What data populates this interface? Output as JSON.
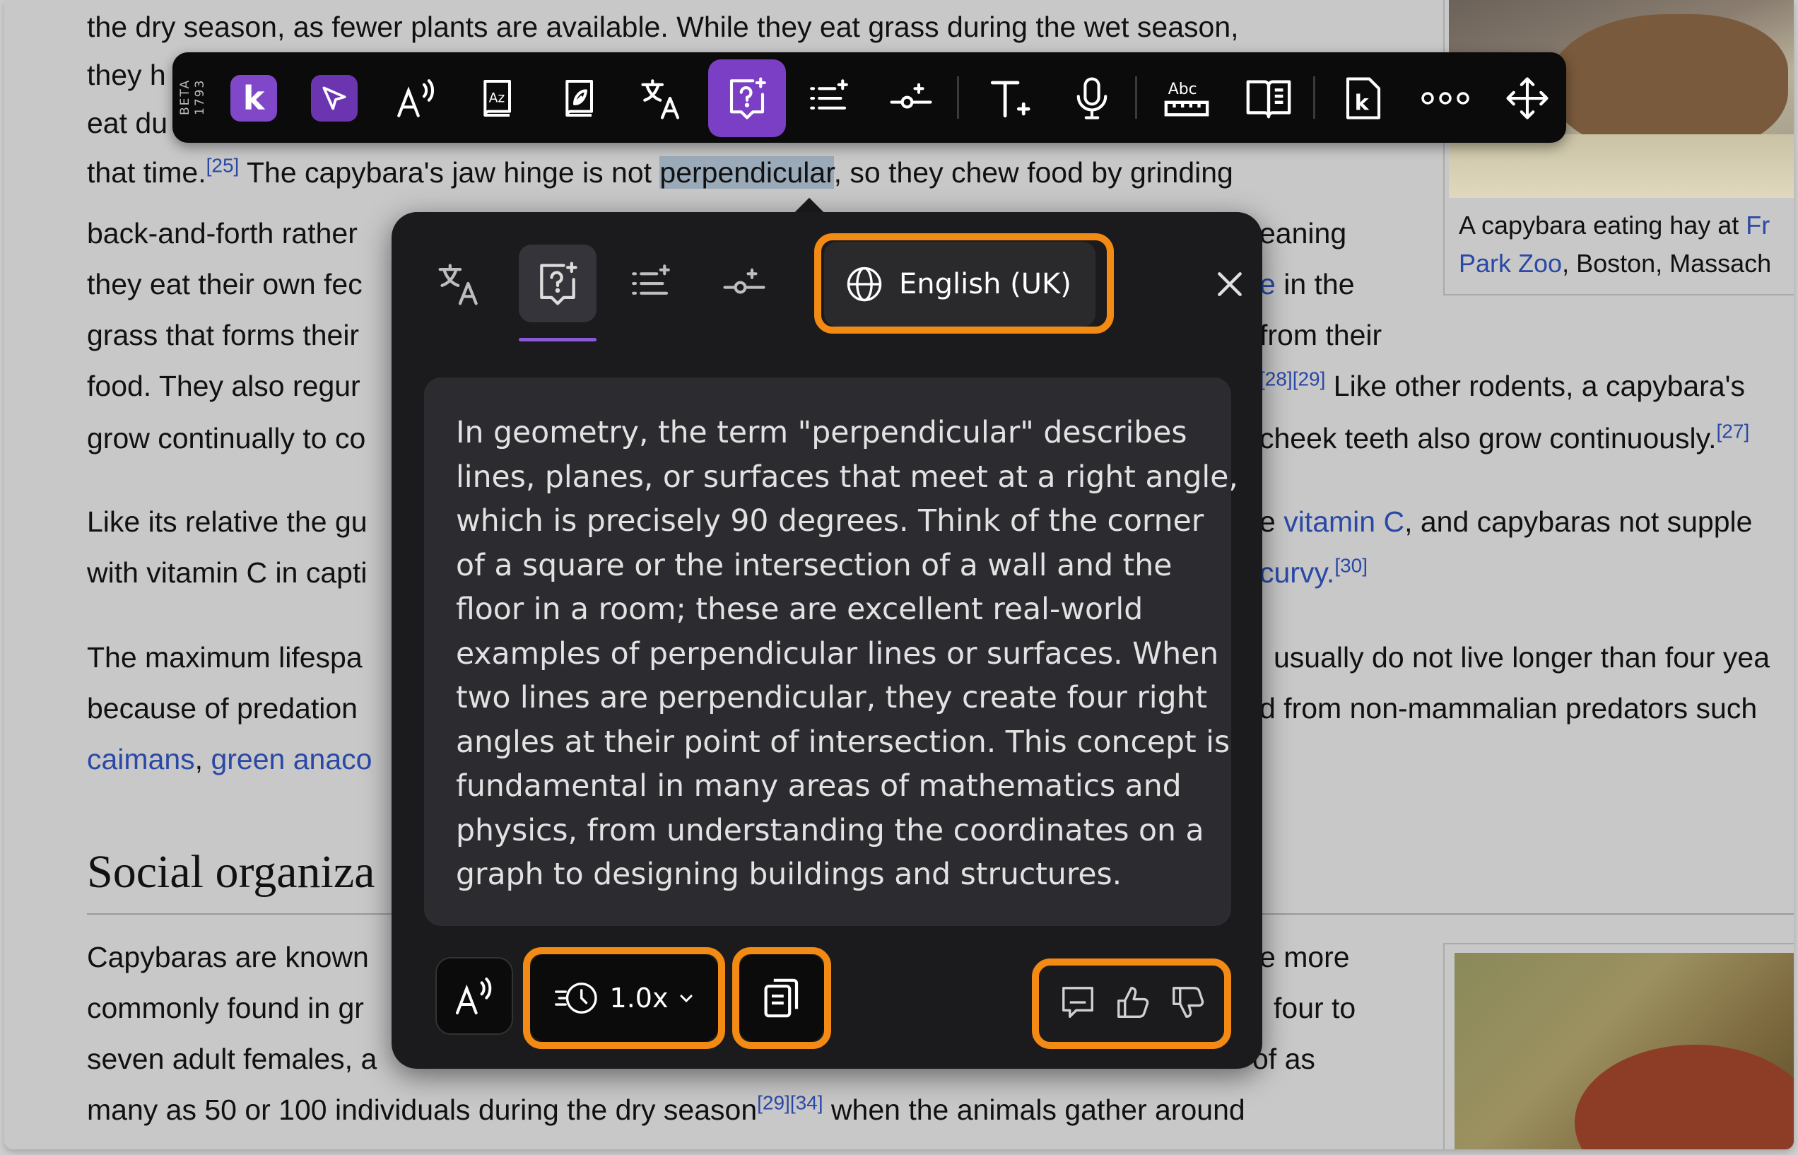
{
  "article": {
    "lines": [
      {
        "text": "the dry season, as fewer plants are available. While they eat grass during the wet season,"
      },
      {
        "text": "they h"
      },
      {
        "text": "eat du"
      },
      {
        "pre": "that time.",
        "sup": "[25]",
        "mid": " The capybara's jaw hinge is not ",
        "highlight": "perpendicular",
        "post": ", so they chew food by grinding"
      },
      {
        "text": "back-and-forth rather",
        "tail": "eaning"
      },
      {
        "text": "they eat their own fec",
        "tail_link": "e",
        "tail": " in the"
      },
      {
        "text": "grass that forms their",
        "tail": "from their"
      },
      {
        "text": "food. They also regur",
        "tail_sup": "[28][29]",
        "tail": " Like other rodents, a capybara's"
      },
      {
        "text": "grow continually to co",
        "tail": "cheek teeth also grow continuously.",
        "tail_sup2": "[27]"
      },
      {
        "text": "Like its relative the gu",
        "tail": "e ",
        "tail_link": "vitamin C",
        "tail2": ", and capybaras not supple"
      },
      {
        "text": "with vitamin C in capti",
        "tail_link": "curvy.",
        "tail_sup": "[30]"
      },
      {
        "text": "The maximum lifespa",
        "tail": "usually do not live longer than four yea"
      },
      {
        "text": "because of predation",
        "tail": "d from non-mammalian predators such"
      },
      {
        "link1": "caimans",
        "sep": ", ",
        "link2": "green anaco"
      },
      {
        "text": "Capybaras are known",
        "tail": "e more"
      },
      {
        "text": "commonly found in gr",
        "tail": "four to"
      },
      {
        "text": "seven adult females, a",
        "tail": "of as"
      },
      {
        "pre": "many as 50 or 100 individuals during the dry season",
        "sup": "[29][34]",
        "post": " when the animals gather around"
      }
    ],
    "heading": "Social organiza",
    "caption": {
      "line1_pre": "A capybara eating hay at ",
      "line1_link": "Fr",
      "line2_link": "Park Zoo",
      "line2_post": ", Boston, Massach"
    }
  },
  "toolbar": {
    "beta_label": "BETA",
    "version": "1793",
    "items": [
      {
        "name": "kurzweil-logo-icon"
      },
      {
        "name": "select-cursor-icon"
      },
      {
        "name": "read-aloud-icon"
      },
      {
        "name": "dictionary-icon"
      },
      {
        "name": "picture-dictionary-icon"
      },
      {
        "name": "translate-icon"
      },
      {
        "name": "ask-ai-icon",
        "active": true
      },
      {
        "name": "summarize-icon"
      },
      {
        "name": "simplify-icon"
      },
      {
        "name": "text-style-icon"
      },
      {
        "name": "microphone-icon"
      },
      {
        "name": "spelling-ruler-icon"
      },
      {
        "name": "reader-view-icon"
      },
      {
        "name": "kurzweil-doc-icon"
      },
      {
        "name": "more-icon"
      },
      {
        "name": "move-icon"
      }
    ],
    "colors": {
      "background": "#0b0b0b",
      "active": "#7a3fc4"
    }
  },
  "popup": {
    "language": "English (UK)",
    "answer_lines": [
      "In geometry, the term \"perpendicular\" describes",
      "lines, planes, or surfaces that meet at a right angle,",
      "which is precisely 90 degrees. Think of the corner",
      "of a square or the intersection of a wall and the",
      "floor in a room; these are excellent real-world",
      "examples of perpendicular lines or surfaces. When",
      "two lines are perpendicular, they create four right",
      "angles at their point of intersection. This concept is",
      "fundamental in many areas of mathematics and",
      "physics, from understanding the coordinates on a",
      "graph to designing buildings and structures."
    ],
    "speed": "1.0x",
    "colors": {
      "highlight_box": "#f38a14",
      "tab_underline": "#8a5ad8"
    }
  }
}
